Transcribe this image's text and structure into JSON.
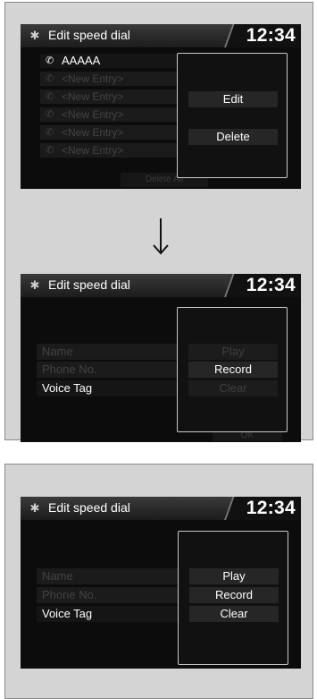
{
  "header": {
    "title": "Edit speed dial",
    "clock": "12:34"
  },
  "step1": {
    "entries": [
      "AAAAA",
      "<New Entry>",
      "<New Entry>",
      "<New Entry>",
      "<New Entry>",
      "<New Entry>"
    ],
    "delete_all": "Delete All",
    "popup": [
      "Edit",
      "Delete"
    ]
  },
  "step2": {
    "fields": [
      "Name",
      "Phone No.",
      "Voice Tag"
    ],
    "popup": [
      "Play",
      "Record",
      "Clear"
    ],
    "footer": "OK"
  },
  "step3": {
    "fields": [
      "Name",
      "Phone No.",
      "Voice Tag"
    ],
    "popup": [
      "Play",
      "Record",
      "Clear"
    ]
  },
  "icons": {
    "settings": "gear-icon",
    "phone": "phone-icon",
    "arrow": "arrow-down-icon"
  }
}
